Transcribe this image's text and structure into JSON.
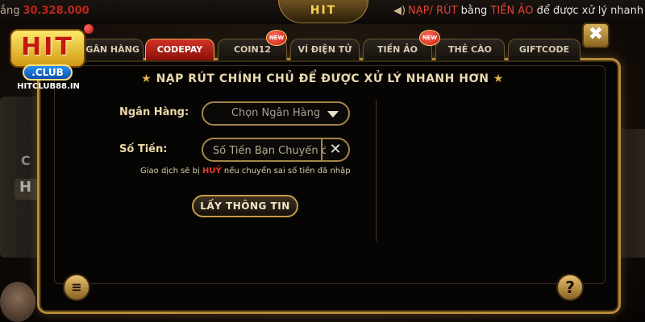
{
  "topbar": {
    "balance_label": "ắng",
    "balance_value": "30.328.000",
    "logo_text": "HIT",
    "marquee_highlight1": "NẠP/ RÚT",
    "marquee_mid": " bằng ",
    "marquee_highlight2": "TIỀN ẢO",
    "marquee_rest": " để được xử lý nhanh hơn"
  },
  "logo": {
    "hit": "HIT",
    "club": ".CLUB",
    "site": "HITCLUB88.IN"
  },
  "background": {
    "ghost1": "C",
    "ghost2": "H"
  },
  "tabs": [
    {
      "label": "NGÂN HÀNG",
      "active": false
    },
    {
      "label": "CODEPAY",
      "active": true
    },
    {
      "label": "COIN12",
      "active": false,
      "new": true
    },
    {
      "label": "VÍ ĐIỆN TỬ",
      "active": false
    },
    {
      "label": "TIỀN ẢO",
      "active": false,
      "new": true
    },
    {
      "label": "THẺ CÀO",
      "active": false
    },
    {
      "label": "GIFTCODE",
      "active": false
    }
  ],
  "badge_new": "NEW",
  "close_icon": "✖",
  "heading": "NẠP RÚT CHÍNH CHỦ ĐỂ ĐƯỢC XỬ LÝ NHANH HƠN",
  "heading_star": "★",
  "form": {
    "bank_label": "Ngân Hàng:",
    "bank_placeholder": "Chọn Ngân Hàng",
    "amount_label": "Số Tiền:",
    "amount_placeholder": "Số Tiền Bạn Chuyển đ",
    "clear_icon": "✕"
  },
  "note": {
    "before": "Giao dịch sẽ bị ",
    "warn": "HUỶ",
    "after": " nếu chuyển sai số tiền đã nhập"
  },
  "submit_label": "LẤY THÔNG TIN",
  "history_icon": "≡",
  "help_icon": "?",
  "colors": {
    "accent_gold": "#b58a3a",
    "active_tab": "#d23226",
    "warn": "#ea3b2e"
  }
}
